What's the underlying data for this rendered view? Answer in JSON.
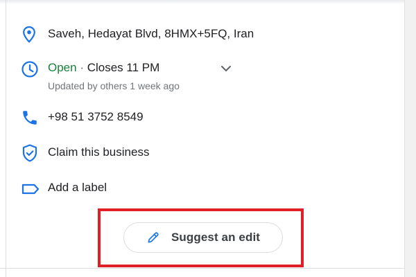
{
  "place": {
    "address": "Saveh, Hedayat Blvd, 8HMX+5FQ, Iran",
    "hours": {
      "status": "Open",
      "separator": " · ",
      "closes": "Closes 11 PM",
      "updated": "Updated by others 1 week ago"
    },
    "phone": "+98 51 3752 8549",
    "claim_label": "Claim this business",
    "label_action": "Add a label",
    "suggest_edit_label": "Suggest an edit"
  },
  "colors": {
    "icon_blue": "#1a73e8",
    "open_green": "#188038",
    "highlight_red": "#e01f26"
  },
  "icons": [
    "location-pin-icon",
    "clock-icon",
    "chevron-down-icon",
    "phone-icon",
    "verified-shield-icon",
    "label-tag-icon",
    "pencil-icon"
  ]
}
